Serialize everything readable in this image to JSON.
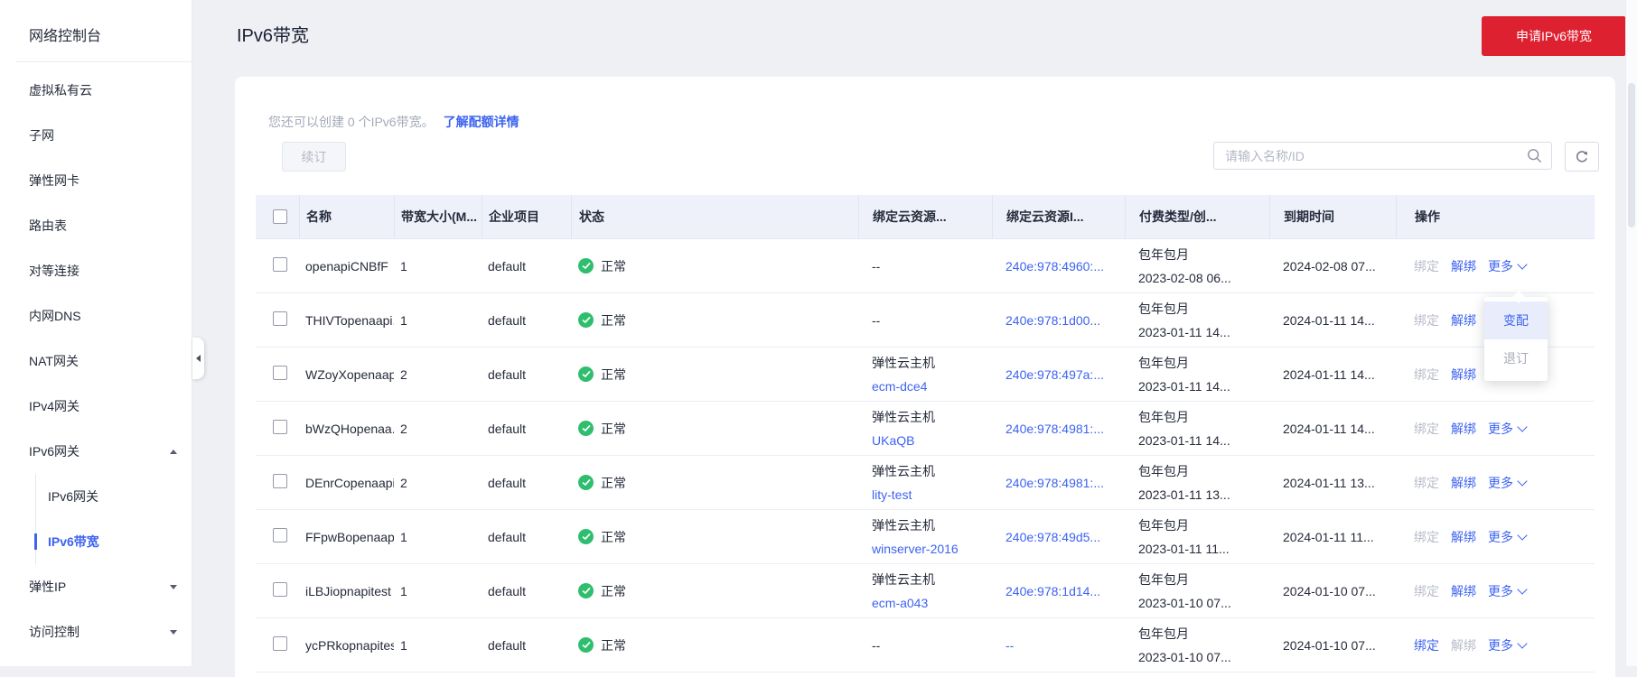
{
  "sidebar": {
    "title": "网络控制台",
    "items": [
      {
        "label": "虚拟私有云"
      },
      {
        "label": "子网"
      },
      {
        "label": "弹性网卡"
      },
      {
        "label": "路由表"
      },
      {
        "label": "对等连接"
      },
      {
        "label": "内网DNS"
      },
      {
        "label": "NAT网关"
      },
      {
        "label": "IPv4网关"
      },
      {
        "label": "IPv6网关",
        "expanded": true,
        "children": [
          {
            "label": "IPv6网关",
            "active": false
          },
          {
            "label": "IPv6带宽",
            "active": true
          }
        ]
      },
      {
        "label": "弹性IP",
        "collapsed": true
      },
      {
        "label": "访问控制",
        "collapsed": true
      }
    ]
  },
  "header": {
    "title": "IPv6带宽",
    "apply_button": "申请IPv6带宽"
  },
  "quota": {
    "text": "您还可以创建 0 个IPv6带宽。",
    "link": "了解配额详情"
  },
  "toolbar": {
    "renew_button": "续订",
    "search_placeholder": "请输入名称/ID"
  },
  "table": {
    "columns": [
      "名称",
      "带宽大小(M...",
      "企业项目",
      "状态",
      "绑定云资源...",
      "绑定云资源I...",
      "付费类型/创...",
      "到期时间",
      "操作"
    ],
    "ops_labels": {
      "bind": "绑定",
      "unbind": "解绑",
      "more": "更多"
    },
    "rows": [
      {
        "name": "openapiCNBfF",
        "bandwidth": "1",
        "project": "default",
        "status": "正常",
        "resource_type": "--",
        "resource_name": "",
        "resource_id": "240e:978:4960:...",
        "billing": "包年包月",
        "created": "2023-02-08 06...",
        "expires": "2024-02-08 07...",
        "bind_enabled": false,
        "unbind_enabled": true,
        "more_open": true
      },
      {
        "name": "THIVTopenaapi...",
        "bandwidth": "1",
        "project": "default",
        "status": "正常",
        "resource_type": "--",
        "resource_name": "",
        "resource_id": "240e:978:1d00...",
        "billing": "包年包月",
        "created": "2023-01-11 14...",
        "expires": "2024-01-11 14...",
        "bind_enabled": false,
        "unbind_enabled": true,
        "more_open": false
      },
      {
        "name": "WZoyXopenaap...",
        "bandwidth": "2",
        "project": "default",
        "status": "正常",
        "resource_type": "弹性云主机",
        "resource_name": "ecm-dce4",
        "resource_id": "240e:978:497a:...",
        "billing": "包年包月",
        "created": "2023-01-11 14...",
        "expires": "2024-01-11 14...",
        "bind_enabled": false,
        "unbind_enabled": true,
        "more_open": false
      },
      {
        "name": "bWzQHopenaa...",
        "bandwidth": "2",
        "project": "default",
        "status": "正常",
        "resource_type": "弹性云主机",
        "resource_name": "UKaQB",
        "resource_id": "240e:978:4981:...",
        "billing": "包年包月",
        "created": "2023-01-11 14...",
        "expires": "2024-01-11 14...",
        "bind_enabled": false,
        "unbind_enabled": true,
        "more_open": false
      },
      {
        "name": "DEnrCopenaapi...",
        "bandwidth": "2",
        "project": "default",
        "status": "正常",
        "resource_type": "弹性云主机",
        "resource_name": "lity-test",
        "resource_id": "240e:978:4981:...",
        "billing": "包年包月",
        "created": "2023-01-11 13...",
        "expires": "2024-01-11 13...",
        "bind_enabled": false,
        "unbind_enabled": true,
        "more_open": false
      },
      {
        "name": "FFpwBopenaapi...",
        "bandwidth": "1",
        "project": "default",
        "status": "正常",
        "resource_type": "弹性云主机",
        "resource_name": "winserver-2016",
        "resource_id": "240e:978:49d5...",
        "billing": "包年包月",
        "created": "2023-01-11 11...",
        "expires": "2024-01-11 11...",
        "bind_enabled": false,
        "unbind_enabled": true,
        "more_open": false
      },
      {
        "name": "iLBJiopnapitest",
        "bandwidth": "1",
        "project": "default",
        "status": "正常",
        "resource_type": "弹性云主机",
        "resource_name": "ecm-a043",
        "resource_id": "240e:978:1d14...",
        "billing": "包年包月",
        "created": "2023-01-10 07...",
        "expires": "2024-01-10 07...",
        "bind_enabled": false,
        "unbind_enabled": true,
        "more_open": false
      },
      {
        "name": "ycPRkopnapitest",
        "bandwidth": "1",
        "project": "default",
        "status": "正常",
        "resource_type": "--",
        "resource_name": "",
        "resource_id": "--",
        "billing": "包年包月",
        "created": "2023-01-10 07...",
        "expires": "2024-01-10 07...",
        "bind_enabled": true,
        "unbind_enabled": false,
        "more_open": false
      }
    ]
  },
  "dropdown": {
    "items": [
      {
        "label": "变配",
        "highlighted": true,
        "disabled": false
      },
      {
        "label": "退订",
        "highlighted": false,
        "disabled": true
      }
    ]
  },
  "colors": {
    "accent_blue": "#3d63f0",
    "danger_red": "#de2130",
    "success_green": "#2fbe6e",
    "table_header_bg": "#eef1fa",
    "dropdown_highlight_bg": "#e9edfb"
  }
}
